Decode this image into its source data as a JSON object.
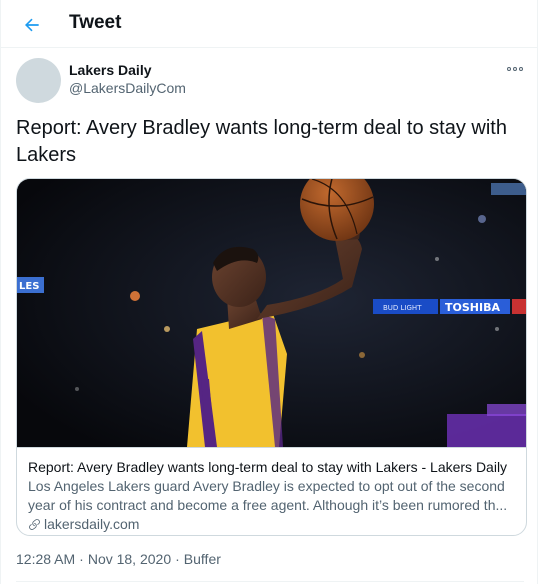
{
  "header": {
    "title": "Tweet",
    "back_icon": "arrow-left-icon"
  },
  "author": {
    "name": "Lakers Daily",
    "handle": "@LakersDailyCom"
  },
  "tweet": {
    "text": "Report: Avery Bradley wants long-term deal to stay with Lakers"
  },
  "card": {
    "title": "Report: Avery Bradley wants long-term deal to stay with Lakers - Lakers Daily",
    "description": "Los Angeles Lakers guard Avery Bradley is expected to opt out of the second year of his contract and become a free agent. Although it’s been rumored th...",
    "domain": "lakersdaily.com",
    "image_signs": {
      "left": "LES",
      "right": "TOSHIBA",
      "small": "BUD LIGHT"
    }
  },
  "meta": {
    "time": "12:28 AM",
    "date": "Nov 18, 2020",
    "source": "Buffer",
    "separator": "·"
  },
  "colors": {
    "accent": "#1d9bf0",
    "text": "#0f1419",
    "secondary": "#536471",
    "jersey": "#f2c12e",
    "purple": "#552583"
  }
}
